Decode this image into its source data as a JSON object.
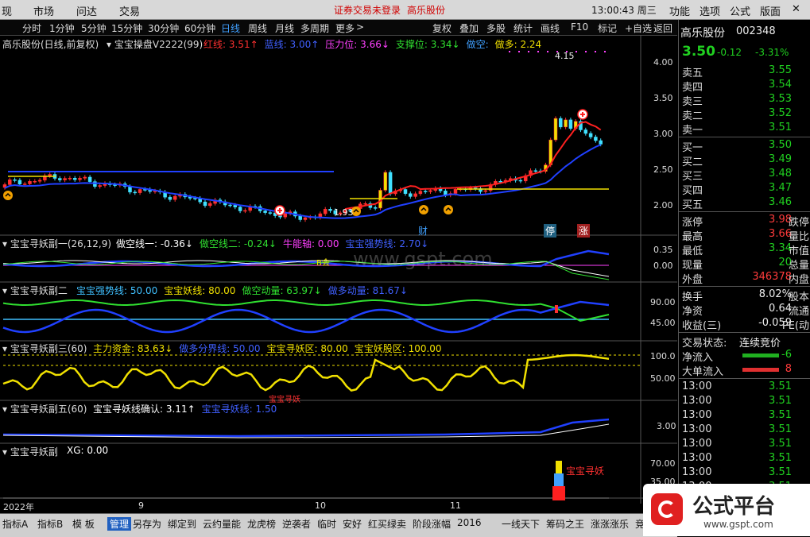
{
  "menubar": {
    "items": [
      "现",
      "市场",
      "问达",
      "交易"
    ],
    "security_msg": "证券交易未登录",
    "stock": "高乐股份",
    "clock": "13:00:43 周三",
    "right_items": [
      "功能",
      "选项",
      "公式",
      "版面"
    ]
  },
  "toolbar": {
    "periods": [
      "分时",
      "1分钟",
      "5分钟",
      "15分钟",
      "30分钟",
      "60分钟",
      "日线",
      "周线",
      "月线",
      "多周期",
      "更多"
    ],
    "actions": [
      "复权",
      "叠加",
      "多股",
      "统计",
      "画线",
      "F10",
      "标记",
      "+自选",
      "返回"
    ]
  },
  "main": {
    "title": "高乐股份(日线,前复权)",
    "indicator": "宝宝操盘V2222(99)",
    "items": [
      {
        "label": "红线:",
        "value": "3.51",
        "dir": "↑",
        "color": "#ff3030"
      },
      {
        "label": "蓝线:",
        "value": "3.00",
        "dir": "↑",
        "color": "#4060ff"
      },
      {
        "label": "压力位:",
        "value": "3.66",
        "dir": "↓",
        "color": "#ff40ff"
      },
      {
        "label": "支撑位:",
        "value": "3.34",
        "dir": "↓",
        "color": "#30e030"
      },
      {
        "label": "做空:",
        "value": "",
        "dir": "",
        "color": "#40a0ff"
      },
      {
        "label": "做多:",
        "value": "2.24",
        "dir": "",
        "color": "#f0e000"
      }
    ],
    "yaxis": [
      "4.00",
      "3.50",
      "3.00",
      "2.50",
      "2.00"
    ],
    "high_label": "4.15",
    "low_label": "1.93",
    "tags": [
      "财",
      "停",
      "涨"
    ]
  },
  "sub1": {
    "name": "宝宝寻妖副一(26,12,9)",
    "items": [
      {
        "label": "做空线一:",
        "value": "-0.36",
        "dir": "↓",
        "color": "#ffffff"
      },
      {
        "label": "做空线二:",
        "value": "-0.24",
        "dir": "↓",
        "color": "#30e030"
      },
      {
        "label": "牛能轴:",
        "value": "0.00",
        "dir": "",
        "color": "#ff40ff"
      },
      {
        "label": "宝宝强势线:",
        "value": "2.70",
        "dir": "↓",
        "color": "#4060ff"
      }
    ],
    "yaxis": [
      "0.35",
      "0.00"
    ],
    "marker": "B会"
  },
  "sub2": {
    "name": "宝宝寻妖副二",
    "items": [
      {
        "label": "宝宝强势线:",
        "value": "50.00",
        "dir": "",
        "color": "#40c0ff"
      },
      {
        "label": "宝宝妖线:",
        "value": "80.00",
        "dir": "",
        "color": "#f0e000"
      },
      {
        "label": "做空动量:",
        "value": "63.97",
        "dir": "↓",
        "color": "#30e030"
      },
      {
        "label": "做多动量:",
        "value": "81.67",
        "dir": "↓",
        "color": "#4060ff"
      }
    ],
    "yaxis": [
      "90.00",
      "45.00"
    ]
  },
  "sub3": {
    "name": "宝宝寻妖副三(60)",
    "items": [
      {
        "label": "主力资金:",
        "value": "83.63",
        "dir": "↓",
        "color": "#f0e000"
      },
      {
        "label": "做多分界线:",
        "value": "50.00",
        "dir": "",
        "color": "#4060ff"
      },
      {
        "label": "宝宝寻妖区:",
        "value": "80.00",
        "dir": "",
        "color": "#f0e000"
      },
      {
        "label": "宝宝妖股区:",
        "value": "100.00",
        "dir": "",
        "color": "#f0e000"
      }
    ],
    "yaxis": [
      "100.0",
      "50.00"
    ],
    "marker": "宝宝寻妖"
  },
  "sub4": {
    "name": "宝宝寻妖副五(60)",
    "items": [
      {
        "label": "宝宝寻妖线确认:",
        "value": "3.11",
        "dir": "↑",
        "color": "#ffffff"
      },
      {
        "label": "宝宝寻妖线:",
        "value": "1.50",
        "dir": "",
        "color": "#4060ff"
      }
    ],
    "yaxis": [
      "3.00"
    ]
  },
  "sub5": {
    "name": "宝宝寻妖副",
    "items": [
      {
        "label": "XG:",
        "value": "0.00",
        "dir": "",
        "color": "#ffffff"
      }
    ],
    "yaxis": [
      "70.00",
      "35.00"
    ],
    "marker": "宝宝寻妖"
  },
  "xaxis": [
    "2022年",
    "9",
    "10",
    "11"
  ],
  "bottom_tabs": [
    "指标A",
    "指标B",
    "模 板",
    "管理",
    "另存为",
    "绑定到",
    "云约量能",
    "龙虎榜",
    "逆袭者",
    "临时",
    "安好",
    "红买绿卖",
    "阶段涨幅",
    "2016",
    "一线天下",
    "筹码之王",
    "涨涨涨乐",
    "竞价"
  ],
  "quote": {
    "name": "高乐股份",
    "code": "002348",
    "price": "3.50",
    "change": "-0.12",
    "pct": "-3.31%",
    "asks": [
      {
        "label": "卖五",
        "price": "3.55"
      },
      {
        "label": "卖四",
        "price": "3.54"
      },
      {
        "label": "卖三",
        "price": "3.53"
      },
      {
        "label": "卖二",
        "price": "3.52"
      },
      {
        "label": "卖一",
        "price": "3.51"
      }
    ],
    "bids": [
      {
        "label": "买一",
        "price": "3.50"
      },
      {
        "label": "买二",
        "price": "3.49"
      },
      {
        "label": "买三",
        "price": "3.48"
      },
      {
        "label": "买四",
        "price": "3.47"
      },
      {
        "label": "买五",
        "price": "3.46"
      }
    ],
    "stats": [
      {
        "l": "涨停",
        "v": "3.98",
        "r": "跌停",
        "c": "#ff3b3b"
      },
      {
        "l": "最高",
        "v": "3.66",
        "r": "量比",
        "c": "#ff3b3b"
      },
      {
        "l": "最低",
        "v": "3.34",
        "r": "市值",
        "c": "#20d020"
      },
      {
        "l": "现量",
        "v": "20",
        "r": "总量",
        "c": "#20d020"
      },
      {
        "l": "外盘",
        "v": "346378",
        "r": "内盘",
        "c": "#ff3b3b"
      }
    ],
    "stats2": [
      {
        "l": "换手",
        "v": "8.02%",
        "r": "股本",
        "c": "#eeeeee"
      },
      {
        "l": "净资",
        "v": "0.64",
        "r": "流通",
        "c": "#eeeeee"
      },
      {
        "l": "收益(三)",
        "v": "-0.059",
        "r": "PE(动",
        "c": "#eeeeee"
      }
    ],
    "trade_state_label": "交易状态:",
    "trade_state": "连续竞价",
    "flows": [
      {
        "l": "净流入",
        "v": "-6"
      },
      {
        "l": "大单流入",
        "v": "8"
      }
    ],
    "ticks": [
      {
        "t": "13:00",
        "p": "3.51"
      },
      {
        "t": "13:00",
        "p": "3.51"
      },
      {
        "t": "13:00",
        "p": "3.51"
      },
      {
        "t": "13:00",
        "p": "3.51"
      },
      {
        "t": "13:00",
        "p": "3.51"
      },
      {
        "t": "13:00",
        "p": "3.51"
      },
      {
        "t": "13:00",
        "p": "3.51"
      },
      {
        "t": "13:00",
        "p": "3.51"
      }
    ]
  },
  "logo": {
    "text": "公式平台",
    "url": "www.gspt.com"
  },
  "watermark": "www.gspt.com"
}
